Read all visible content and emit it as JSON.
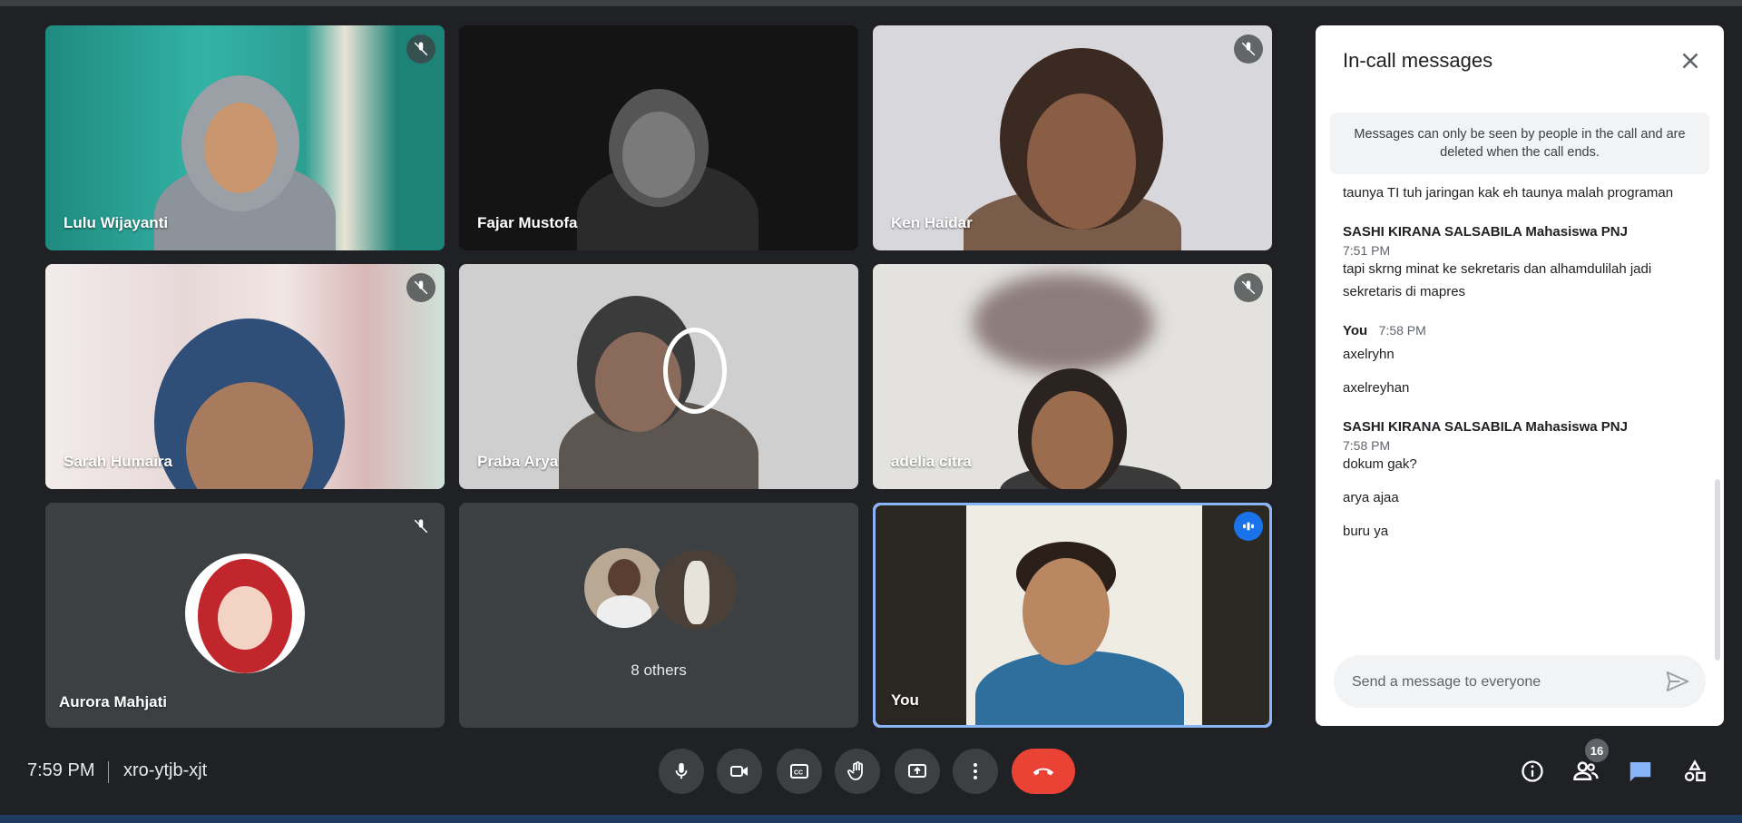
{
  "participants": [
    {
      "name": "Lulu Wijayanti",
      "muted": true
    },
    {
      "name": "Fajar Mustofa",
      "muted": false
    },
    {
      "name": "Ken Haidar",
      "muted": true
    },
    {
      "name": "Sarah Humaira",
      "muted": true
    },
    {
      "name": "Praba Arya",
      "muted": false
    },
    {
      "name": "adelia citra",
      "muted": true
    },
    {
      "name": "Aurora Mahjati",
      "muted": true
    },
    {
      "name": "8 others"
    },
    {
      "name": "You",
      "speaking": true
    }
  ],
  "chat": {
    "title": "In-call messages",
    "notice": "Messages can only be seen by people in the call and are deleted when the call ends.",
    "messages": [
      {
        "texts": [
          "taunya TI tuh jaringan kak eh taunya malah programan"
        ]
      },
      {
        "sender": "SASHI KIRANA SALSABILA Mahasiswa PNJ",
        "time": "7:51 PM",
        "texts": [
          "tapi skrng minat ke sekretaris dan alhamdulilah jadi sekretaris di mapres"
        ]
      },
      {
        "sender": "You",
        "time": "7:58 PM",
        "texts": [
          "axelryhn",
          "axelreyhan"
        ]
      },
      {
        "sender": "SASHI KIRANA SALSABILA Mahasiswa PNJ",
        "time": "7:58 PM",
        "texts": [
          "dokum gak?",
          "arya ajaa",
          "buru ya"
        ]
      }
    ],
    "input_placeholder": "Send a message to everyone"
  },
  "meeting": {
    "time": "7:59 PM",
    "code": "xro-ytjb-xjt",
    "participants_count": "16"
  },
  "colors": {
    "background": "#202124",
    "end_call": "#ea4335",
    "accent": "#8ab4f8",
    "speaking": "#1a73e8"
  },
  "icons": [
    "mic-icon",
    "camera-icon",
    "captions-icon",
    "raise-hand-icon",
    "present-icon",
    "more-icon",
    "end-call-icon",
    "info-icon",
    "people-icon",
    "chat-icon",
    "activities-icon"
  ]
}
